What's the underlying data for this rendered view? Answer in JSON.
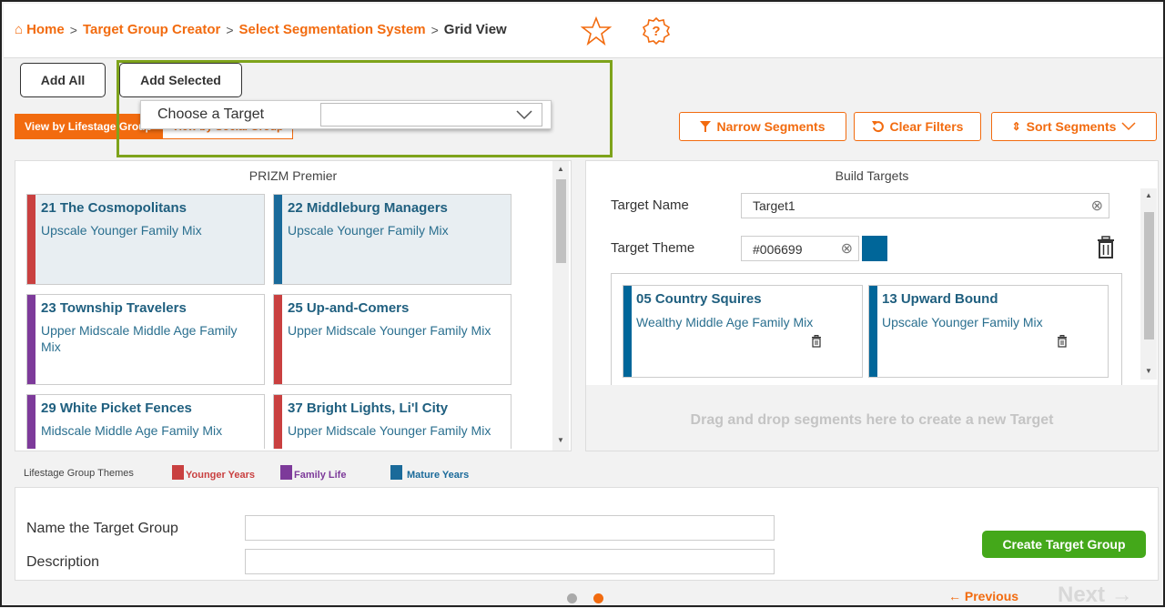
{
  "breadcrumb": {
    "home": "Home",
    "items": [
      "Target Group Creator",
      "Select Segmentation System"
    ],
    "current": "Grid View"
  },
  "toolbar": {
    "add_all": "Add All",
    "add_selected": "Add Selected",
    "choose_target": "Choose a Target"
  },
  "tabs": {
    "lifestage": "View by Lifestage Group",
    "social": "View by Social Group"
  },
  "filters": {
    "narrow": "Narrow Segments",
    "clear": "Clear Filters",
    "sort": "Sort Segments"
  },
  "prizm": {
    "title": "PRIZM Premier",
    "segments": [
      {
        "name": "21 The Cosmopolitans",
        "desc": "Upscale Younger Family Mix",
        "color": "#c94040"
      },
      {
        "name": "22 Middleburg Managers",
        "desc": "Upscale Younger Family Mix",
        "color": "#1a6a9a"
      },
      {
        "name": "23 Township Travelers",
        "desc": "Upper Midscale Middle Age Family Mix",
        "color": "#7d3a9a"
      },
      {
        "name": "25 Up-and-Comers",
        "desc": "Upper Midscale Younger Family Mix",
        "color": "#c94040"
      },
      {
        "name": "29 White Picket Fences",
        "desc": "Midscale Middle Age Family Mix",
        "color": "#7d3a9a"
      },
      {
        "name": "37 Bright Lights, Li'l City",
        "desc": "Upper Midscale Younger Family Mix",
        "color": "#c94040"
      }
    ]
  },
  "build": {
    "title": "Build Targets",
    "target_name_label": "Target Name",
    "target_name_value": "Target1",
    "target_theme_label": "Target Theme",
    "target_theme_value": "#006699",
    "theme_color": "#006699",
    "cards": [
      {
        "name": "05 Country Squires",
        "desc": "Wealthy Middle Age Family Mix"
      },
      {
        "name": "13 Upward Bound",
        "desc": "Upscale Younger Family Mix"
      }
    ],
    "drop_hint": "Drag and drop segments here to create a new Target"
  },
  "legend": {
    "label": "Lifestage Group Themes",
    "items": [
      {
        "label": "Younger Years",
        "color": "#c94040"
      },
      {
        "label": "Family Life",
        "color": "#7d3a9a"
      },
      {
        "label": "Mature Years",
        "color": "#1a6a9a"
      }
    ]
  },
  "form": {
    "name_label": "Name the Target Group",
    "desc_label": "Description",
    "create": "Create Target Group"
  },
  "nav": {
    "previous": "Previous",
    "next": "Next"
  }
}
